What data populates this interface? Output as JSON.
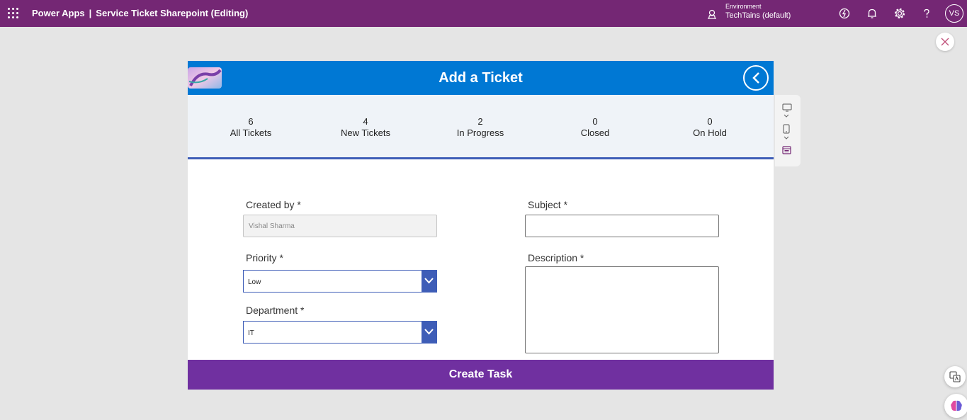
{
  "topbar": {
    "app_name": "Power Apps",
    "separator": "|",
    "document_title": "Service Ticket Sharepoint (Editing)",
    "environment_label": "Environment",
    "environment_value": "TechTains (default)",
    "avatar_initials": "VS",
    "icons": [
      "waffle-icon",
      "environment-icon",
      "copilot-icon",
      "bell-icon",
      "gear-icon",
      "help-icon"
    ]
  },
  "app": {
    "title": "Add a Ticket",
    "stats": [
      {
        "count": "6",
        "label": "All Tickets"
      },
      {
        "count": "4",
        "label": "New Tickets"
      },
      {
        "count": "2",
        "label": "In Progress"
      },
      {
        "count": "0",
        "label": "Closed"
      },
      {
        "count": "0",
        "label": "On Hold"
      }
    ],
    "form": {
      "created_by_label": "Created by *",
      "created_by_value": "Vishal Sharma",
      "priority_label": "Priority *",
      "priority_value": "Low",
      "department_label": "Department *",
      "department_value": "IT",
      "subject_label": "Subject *",
      "subject_value": "",
      "description_label": "Description *",
      "description_value": ""
    },
    "create_button_label": "Create Task"
  },
  "colors": {
    "topbar": "#742774",
    "header": "#0078d4",
    "stats_bg": "#eff3f8",
    "accent_blue": "#3e5db7",
    "create_button": "#7030a0"
  }
}
